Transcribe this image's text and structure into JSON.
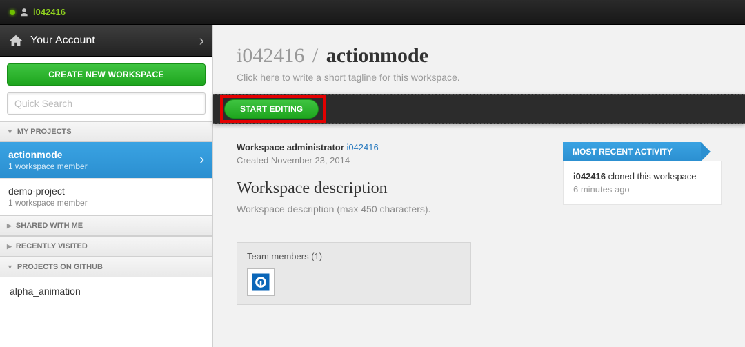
{
  "topbar": {
    "username": "i042416"
  },
  "sidebar": {
    "account_label": "Your Account",
    "create_label": "CREATE NEW WORKSPACE",
    "search_placeholder": "Quick Search",
    "sections": {
      "my_projects": "MY PROJECTS",
      "shared": "SHARED WITH ME",
      "recent": "RECENTLY VISITED",
      "github": "PROJECTS ON GITHUB"
    },
    "projects": [
      {
        "name": "actionmode",
        "meta": "1 workspace member",
        "active": true
      },
      {
        "name": "demo-project",
        "meta": "1 workspace member",
        "active": false
      }
    ],
    "github_items": [
      "alpha_animation"
    ]
  },
  "workspace": {
    "owner": "i042416",
    "slash": "/",
    "name": "actionmode",
    "tagline": "Click here to write a short tagline for this workspace.",
    "start_label": "START EDITING",
    "admin_label": "Workspace administrator",
    "admin_user": "i042416",
    "created": "Created November 23, 2014",
    "desc_heading": "Workspace description",
    "desc_text": "Workspace description (max 450 characters).",
    "team_heading": "Team members (1)"
  },
  "activity": {
    "ribbon": "MOST RECENT ACTIVITY",
    "items": [
      {
        "user": "i042416",
        "text": " cloned this workspace",
        "time": "6 minutes ago"
      }
    ]
  }
}
